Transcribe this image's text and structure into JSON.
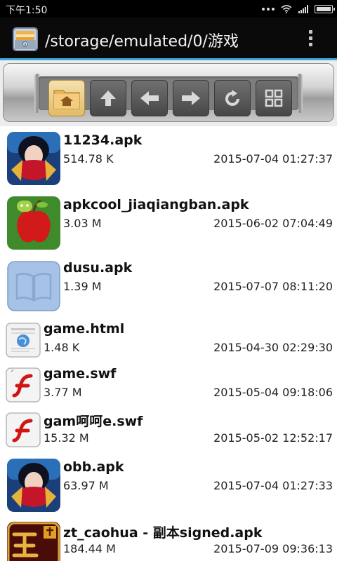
{
  "status_bar": {
    "time": "下午1:50",
    "icons": [
      "more-dots-icon",
      "wifi-icon",
      "signal-icon",
      "battery-icon"
    ]
  },
  "title_bar": {
    "path": "/storage/emulated/0/游戏",
    "app_icon": "file-manager-icon",
    "menu_icon": "overflow-menu-icon"
  },
  "toolbar": {
    "buttons": [
      {
        "icon": "home-folder-icon",
        "active": true
      },
      {
        "icon": "arrow-up-icon",
        "active": false
      },
      {
        "icon": "arrow-back-icon",
        "active": false
      },
      {
        "icon": "arrow-forward-icon",
        "active": false
      },
      {
        "icon": "refresh-icon",
        "active": false
      },
      {
        "icon": "grid-view-icon",
        "active": false
      }
    ]
  },
  "colors": {
    "accent": "#39a9dc",
    "title_bar_bg": "#0a0a0a",
    "list_bg": "#ffffff"
  },
  "files": [
    {
      "name": "11234.apk",
      "size": "514.78 K",
      "date": "2015-07-04 01:27:37",
      "icon": "game-app-icon"
    },
    {
      "name": "apkcool_jiaqiangban.apk",
      "size": "3.03 M",
      "date": "2015-06-02 07:04:49",
      "icon": "android-apple-app-icon"
    },
    {
      "name": "dusu.apk",
      "size": "1.39 M",
      "date": "2015-07-07 08:11:20",
      "icon": "book-app-icon"
    },
    {
      "name": "game.html",
      "size": "1.48 K",
      "date": "2015-04-30 02:29:30",
      "icon": "html-file-icon"
    },
    {
      "name": "game.swf",
      "size": "3.77 M",
      "date": "2015-05-04 09:18:06",
      "icon": "flash-file-icon"
    },
    {
      "name": "gam呵呵e.swf",
      "size": "15.32 M",
      "date": "2015-05-02 12:52:17",
      "icon": "flash-file-icon"
    },
    {
      "name": "obb.apk",
      "size": "63.97 M",
      "date": "2015-07-04 01:27:33",
      "icon": "game-app-icon"
    },
    {
      "name": "zt_caohua - 副本signed.apk",
      "size": "184.44 M",
      "date": "2015-07-09 09:36:13",
      "icon": "zhengtu-app-icon"
    }
  ]
}
